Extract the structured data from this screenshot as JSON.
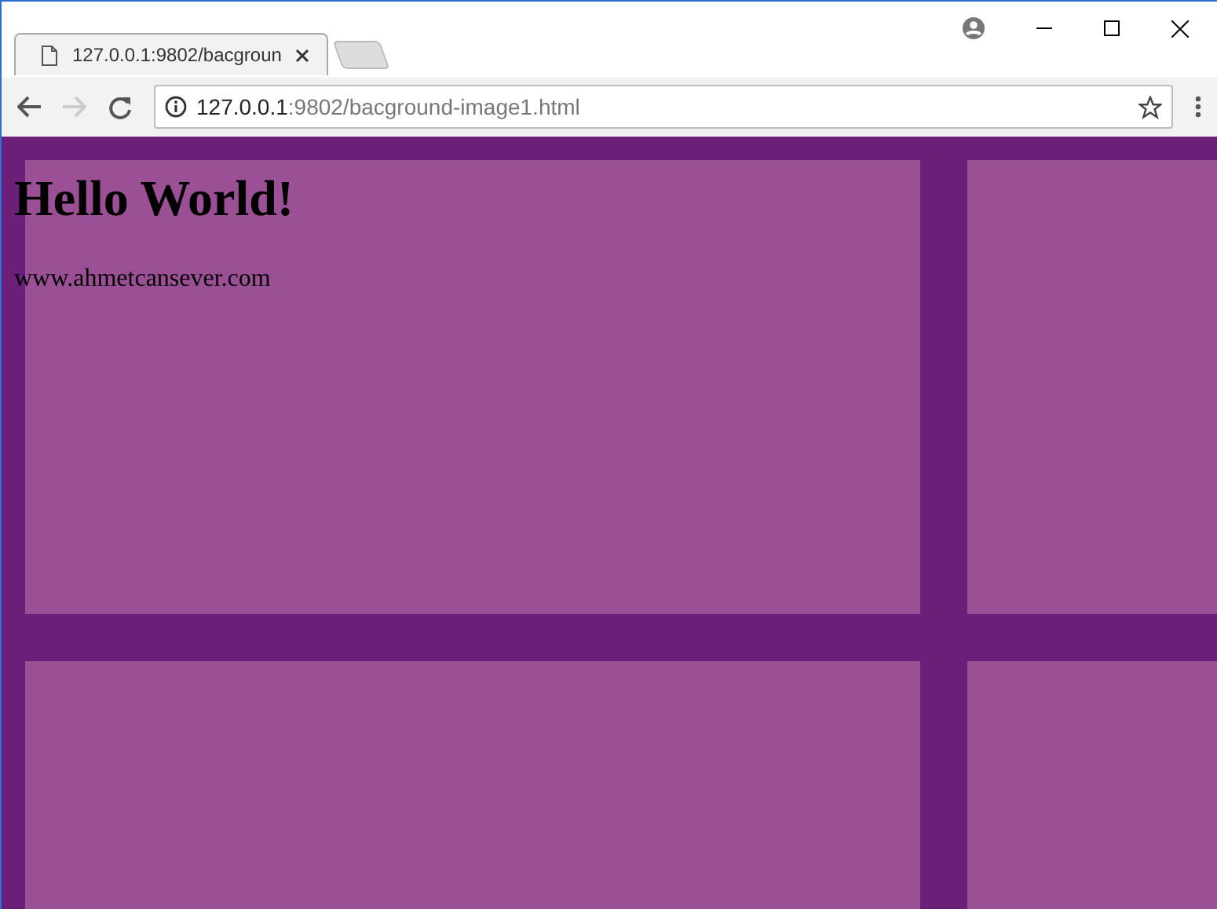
{
  "tabs": [
    {
      "title": "127.0.0.1:9802/bacgroun",
      "selected": true
    }
  ],
  "address_bar": {
    "host": "127.0.0.1",
    "path": ":9802/bacground-image1.html"
  },
  "page": {
    "heading": "Hello World!",
    "text": "www.ahmetcansever.com"
  }
}
